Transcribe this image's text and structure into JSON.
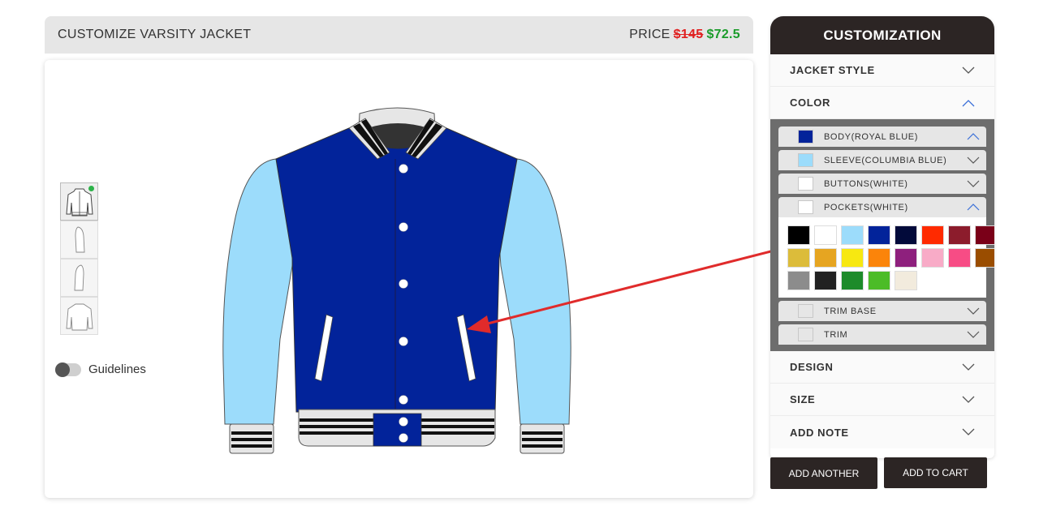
{
  "header": {
    "title": "CUSTOMIZE VARSITY JACKET",
    "price_label": "PRICE",
    "price_old": "$145",
    "price_new": "$72.5"
  },
  "views": [
    "front-view",
    "left-sleeve-view",
    "right-sleeve-view",
    "back-view"
  ],
  "guidelines": {
    "label": "Guidelines",
    "enabled": false
  },
  "jacket_colors": {
    "body": "#02239a",
    "sleeve": "#9cdcfb",
    "buttons": "#ffffff",
    "pockets": "#ffffff",
    "trim_base": "#e6e6e6",
    "trim_stripe": "#111111"
  },
  "panel": {
    "title": "CUSTOMIZATION",
    "sections_top": [
      {
        "label": "JACKET STYLE",
        "expanded": false
      },
      {
        "label": "COLOR",
        "expanded": true
      }
    ],
    "color_items": [
      {
        "label": "BODY(ROYAL BLUE)",
        "swatch": "#02239a",
        "expanded": true
      },
      {
        "label": "SLEEVE(COLUMBIA BLUE)",
        "swatch": "#9cdcfb",
        "expanded": false
      },
      {
        "label": "BUTTONS(WHITE)",
        "swatch": "#ffffff",
        "expanded": false
      },
      {
        "label": "POCKETS(WHITE)",
        "swatch": "#ffffff",
        "expanded": true
      }
    ],
    "palette": [
      "#000000",
      "#ffffff",
      "#9cdcfb",
      "#02239a",
      "#020a3a",
      "#ff2a00",
      "#8c1c2c",
      "#7a0018",
      "#dcbc3a",
      "#e6a521",
      "#f7e811",
      "#fb840a",
      "#8e207d",
      "#f8abc7",
      "#f74c85",
      "#9a4d00",
      "#8c8c8c",
      "#222222",
      "#1d8b2a",
      "#4cbc27",
      "#f2ebdd"
    ],
    "color_items_after": [
      {
        "label": "TRIM BASE",
        "swatch": "#e6e6e6",
        "expanded": false
      },
      {
        "label": "TRIM",
        "swatch": "#e6e6e6",
        "expanded": false
      }
    ],
    "sections_bottom": [
      {
        "label": "DESIGN",
        "expanded": false
      },
      {
        "label": "SIZE",
        "expanded": false
      },
      {
        "label": "ADD NOTE",
        "expanded": false
      }
    ]
  },
  "buttons": {
    "add_another": "ADD ANOTHER",
    "add_to_cart": "ADD TO CART"
  }
}
